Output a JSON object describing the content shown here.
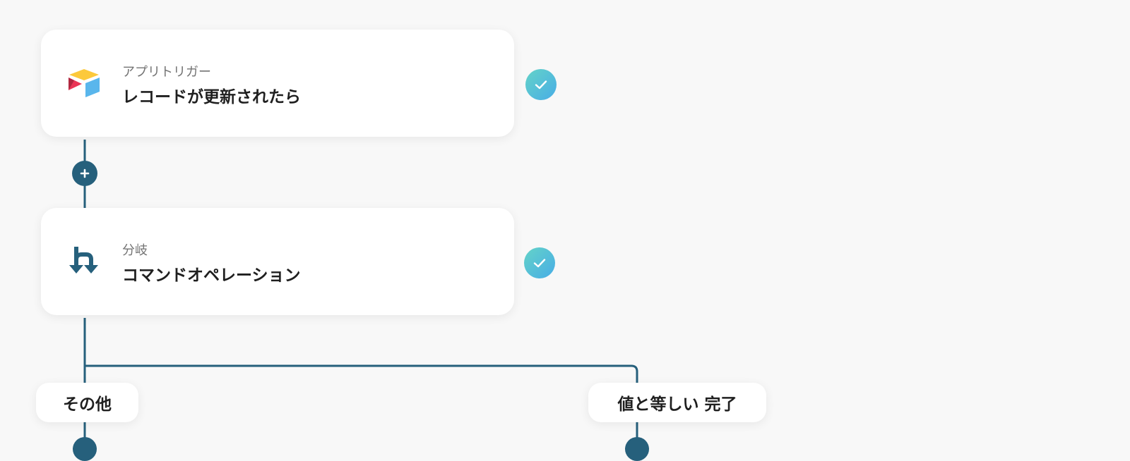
{
  "steps": [
    {
      "subtitle": "アプリトリガー",
      "title": "レコードが更新されたら",
      "icon": "airtable-icon",
      "status": "completed"
    },
    {
      "subtitle": "分岐",
      "title": "コマンドオペレーション",
      "icon": "branch-icon",
      "status": "completed"
    }
  ],
  "branches": [
    {
      "label": "その他"
    },
    {
      "label": "値と等しい 完了"
    }
  ],
  "colors": {
    "connector": "#26607c",
    "check_gradient_start": "#64d3c8",
    "check_gradient_end": "#48ade6",
    "background": "#f8f8f8"
  },
  "icons": {
    "add": "plus-icon",
    "check": "checkmark-icon"
  }
}
